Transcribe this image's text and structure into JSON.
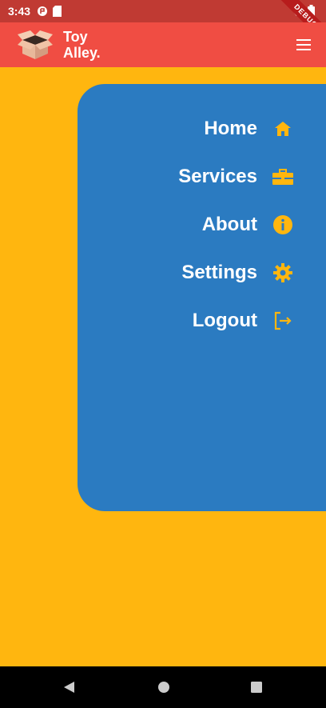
{
  "status_bar": {
    "time": "3:43",
    "debug_label": "DEBUG"
  },
  "app_bar": {
    "brand_line1": "Toy",
    "brand_line2": "Alley.",
    "logo_icon": "open-box-icon",
    "menu_icon": "hamburger-menu-icon"
  },
  "drawer": {
    "items": [
      {
        "label": "Home",
        "icon": "home-icon"
      },
      {
        "label": "Services",
        "icon": "briefcase-icon"
      },
      {
        "label": "About",
        "icon": "info-icon"
      },
      {
        "label": "Settings",
        "icon": "gear-icon"
      },
      {
        "label": "Logout",
        "icon": "logout-icon"
      }
    ]
  },
  "colors": {
    "background": "#ffb60f",
    "app_bar": "#f04d43",
    "drawer": "#2b7bc1",
    "icon_accent": "#ffb60f"
  }
}
